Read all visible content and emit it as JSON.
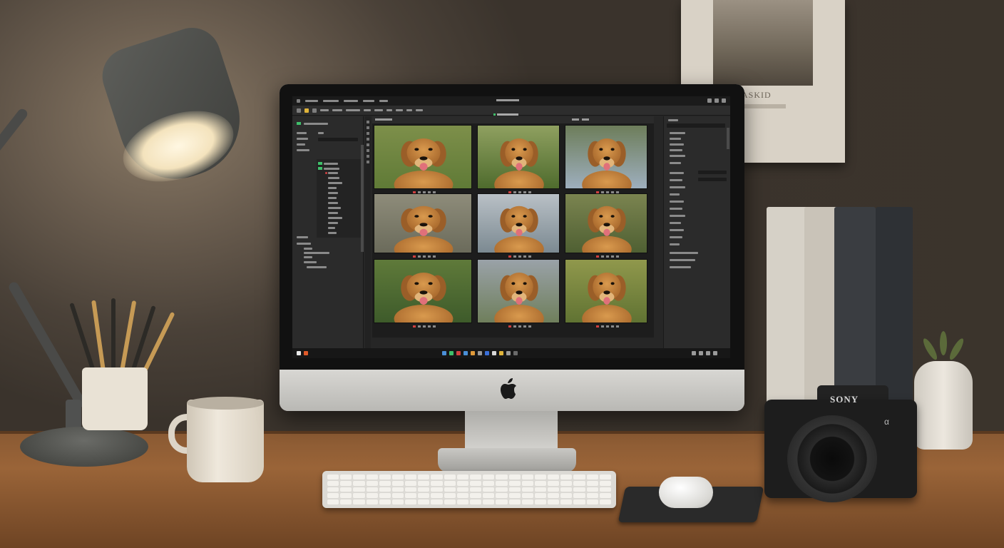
{
  "scene": {
    "description_free": true,
    "monitor_brand_glyph": "apple-icon",
    "camera_brand": "SONY",
    "camera_model_mark": "α",
    "poster_text": "ASKID"
  },
  "screen": {
    "app": "photo-culling-app",
    "grid_columns": 3,
    "grid_rows": 3,
    "thumbnail_subject": "golden-retriever"
  },
  "colors": {
    "accent_green": "#3fbf6a",
    "accent_yellow": "#e0b43a",
    "accent_blue": "#4a8fd8",
    "flag_red": "#d04040"
  }
}
